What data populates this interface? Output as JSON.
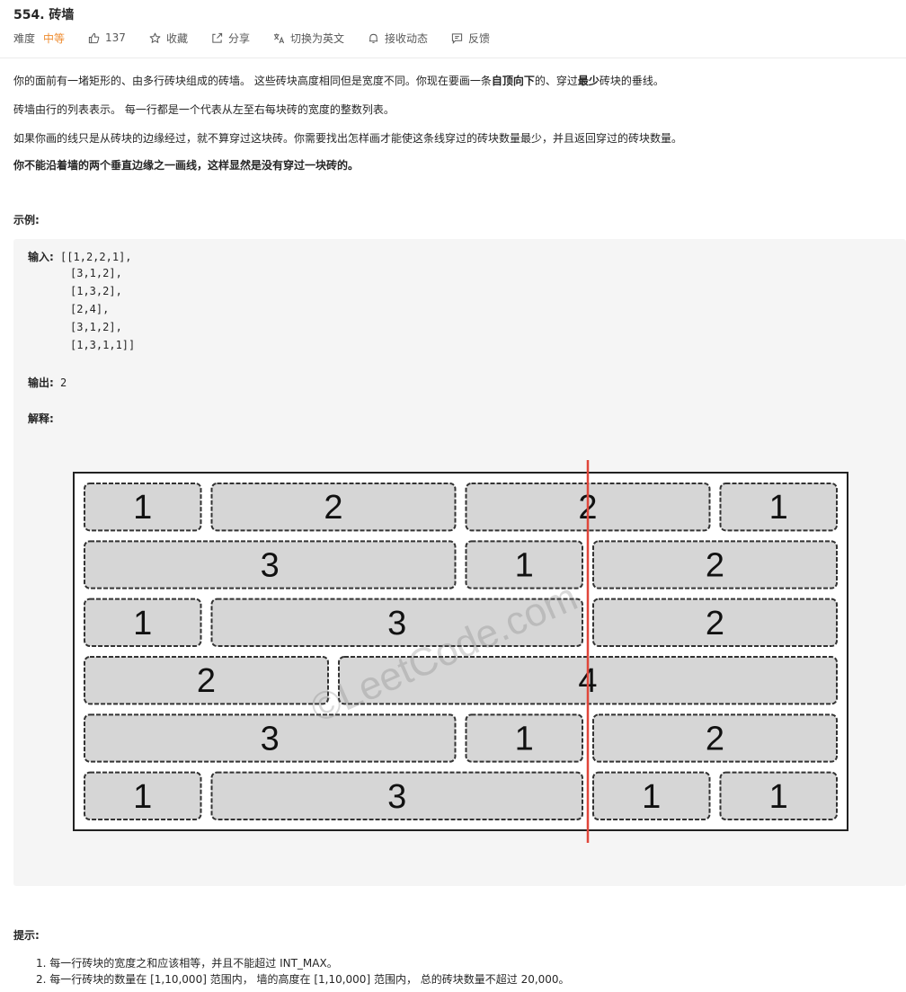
{
  "header": {
    "title": "554. 砖墙",
    "difficulty_label": "难度",
    "difficulty": "中等",
    "likes": "137",
    "favorite": "收藏",
    "share": "分享",
    "switch_lang": "切换为英文",
    "subscribe": "接收动态",
    "feedback": "反馈"
  },
  "description": {
    "p1_a": "你的面前有一堵矩形的、由多行砖块组成的砖墙。 这些砖块高度相同但是宽度不同。你现在要画一条",
    "p1_b": "自顶向下",
    "p1_c": "的、穿过",
    "p1_d": "最少",
    "p1_e": "砖块的垂线。",
    "p2": "砖墙由行的列表表示。 每一行都是一个代表从左至右每块砖的宽度的整数列表。",
    "p3": "如果你画的线只是从砖块的边缘经过，就不算穿过这块砖。你需要找出怎样画才能使这条线穿过的砖块数量最少，并且返回穿过的砖块数量。",
    "p4": "你不能沿着墙的两个垂直边缘之一画线，这样显然是没有穿过一块砖的。"
  },
  "example": {
    "label": "示例:",
    "input_label": "输入:",
    "input_lines": [
      "[[1,2,2,1],",
      "[3,1,2],",
      "[1,3,2],",
      "[2,4],",
      "[3,1,2],",
      "[1,3,1,1]]"
    ],
    "output_label": "输出:",
    "output_value": "2",
    "explain_label": "解释:"
  },
  "wall": {
    "rows": [
      [
        1,
        2,
        2,
        1
      ],
      [
        3,
        1,
        2
      ],
      [
        1,
        3,
        2
      ],
      [
        2,
        4
      ],
      [
        3,
        1,
        2
      ],
      [
        1,
        3,
        1,
        1
      ]
    ],
    "line_at": 4,
    "watermark": "©LeetCode.com",
    "brick_color": "#d6d6d6",
    "line_color": "#e0463a"
  },
  "hints": {
    "label": "提示:",
    "items": [
      "1. 每一行砖块的宽度之和应该相等，并且不能超过 INT_MAX。",
      "2. 每一行砖块的数量在 [1,10,000] 范围内， 墙的高度在 [1,10,000] 范围内， 总的砖块数量不超过 20,000。"
    ]
  }
}
